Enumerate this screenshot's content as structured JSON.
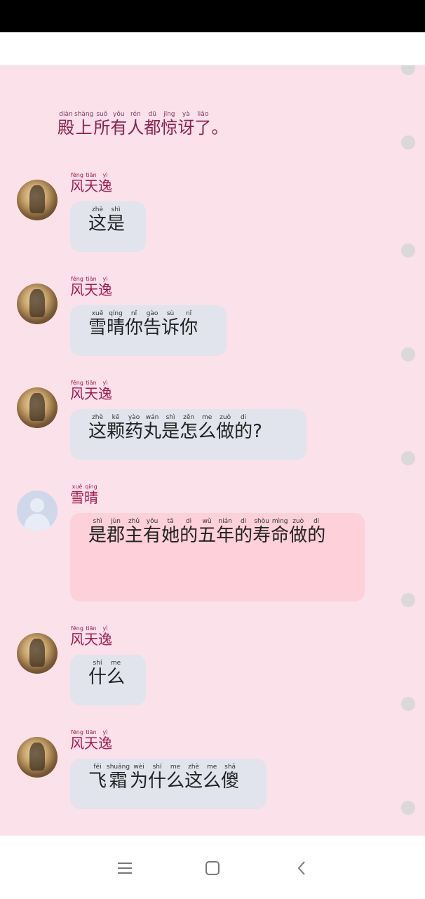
{
  "narration": {
    "chars": [
      {
        "c": "殿",
        "p": "diàn"
      },
      {
        "c": "上",
        "p": "shàng"
      },
      {
        "c": "所",
        "p": "suǒ"
      },
      {
        "c": "有",
        "p": "yǒu"
      },
      {
        "c": "人",
        "p": "rén"
      },
      {
        "c": "都",
        "p": "dū"
      },
      {
        "c": "惊",
        "p": "jīng"
      },
      {
        "c": "讶",
        "p": "yà"
      },
      {
        "c": "了",
        "p": "liǎo"
      },
      {
        "c": "。",
        "p": ""
      }
    ]
  },
  "messages": [
    {
      "speaker": [
        {
          "c": "风",
          "p": "fēng"
        },
        {
          "c": "天",
          "p": "tiān"
        },
        {
          "c": "逸",
          "p": "yì"
        }
      ],
      "avatar": "character-portrait",
      "text": [
        {
          "c": "这",
          "p": "zhè"
        },
        {
          "c": "是",
          "p": "shì"
        }
      ]
    },
    {
      "speaker": [
        {
          "c": "风",
          "p": "fēng"
        },
        {
          "c": "天",
          "p": "tiān"
        },
        {
          "c": "逸",
          "p": "yì"
        }
      ],
      "avatar": "character-portrait",
      "text": [
        {
          "c": "雪",
          "p": "xuě"
        },
        {
          "c": "晴",
          "p": "qíng"
        },
        {
          "c": "你",
          "p": "nǐ"
        },
        {
          "c": "告",
          "p": "gào"
        },
        {
          "c": "诉",
          "p": "sù"
        },
        {
          "c": "你",
          "p": "nǐ"
        }
      ]
    },
    {
      "speaker": [
        {
          "c": "风",
          "p": "fēng"
        },
        {
          "c": "天",
          "p": "tiān"
        },
        {
          "c": "逸",
          "p": "yì"
        }
      ],
      "avatar": "character-portrait",
      "text": [
        {
          "c": "这",
          "p": "zhè"
        },
        {
          "c": "颗",
          "p": "kē"
        },
        {
          "c": "药",
          "p": "yào"
        },
        {
          "c": "丸",
          "p": "wán"
        },
        {
          "c": "是",
          "p": "shì"
        },
        {
          "c": "怎",
          "p": "zěn"
        },
        {
          "c": "么",
          "p": "me"
        },
        {
          "c": "做",
          "p": "zuò"
        },
        {
          "c": "的",
          "p": "di"
        },
        {
          "c": "?",
          "p": ""
        }
      ]
    },
    {
      "speaker": [
        {
          "c": "雪",
          "p": "xuě"
        },
        {
          "c": "晴",
          "p": "qíng"
        }
      ],
      "avatar": "default-user",
      "text": [
        {
          "c": "是",
          "p": "shì"
        },
        {
          "c": "郡",
          "p": "jùn"
        },
        {
          "c": "主",
          "p": "zhǔ"
        },
        {
          "c": "有",
          "p": "yǒu"
        },
        {
          "c": "她",
          "p": "tā"
        },
        {
          "c": "的",
          "p": "di"
        },
        {
          "c": "五",
          "p": "wǔ"
        },
        {
          "c": "年",
          "p": "nián"
        },
        {
          "c": "的",
          "p": "di"
        },
        {
          "c": "寿",
          "p": "shòu"
        },
        {
          "c": "命",
          "p": "mìng"
        },
        {
          "c": "做",
          "p": "zuò"
        },
        {
          "c": "的",
          "p": "di"
        }
      ]
    },
    {
      "speaker": [
        {
          "c": "风",
          "p": "fēng"
        },
        {
          "c": "天",
          "p": "tiān"
        },
        {
          "c": "逸",
          "p": "yì"
        }
      ],
      "avatar": "character-portrait",
      "text": [
        {
          "c": "什",
          "p": "shí"
        },
        {
          "c": "么",
          "p": "me"
        }
      ]
    },
    {
      "speaker": [
        {
          "c": "风",
          "p": "fēng"
        },
        {
          "c": "天",
          "p": "tiān"
        },
        {
          "c": "逸",
          "p": "yì"
        }
      ],
      "avatar": "character-portrait",
      "text": [
        {
          "c": "飞",
          "p": "fēi"
        },
        {
          "c": "霜",
          "p": "shuāng"
        },
        {
          "c": "为",
          "p": "wèi"
        },
        {
          "c": "什",
          "p": "shí"
        },
        {
          "c": "么",
          "p": "me"
        },
        {
          "c": "这",
          "p": "zhè"
        },
        {
          "c": "么",
          "p": "me"
        },
        {
          "c": "傻",
          "p": "shǎ"
        }
      ]
    }
  ],
  "colors": {
    "chat_background": "#fae1ea",
    "speaker_name": "#a3184e",
    "narration_text": "#8a1f4d",
    "bubble_other": "#e1e4ec",
    "bubble_self": "#fdd0da"
  },
  "nav": {
    "menu_icon": "menu-icon",
    "home_icon": "home-square-icon",
    "back_icon": "back-chevron-icon"
  }
}
